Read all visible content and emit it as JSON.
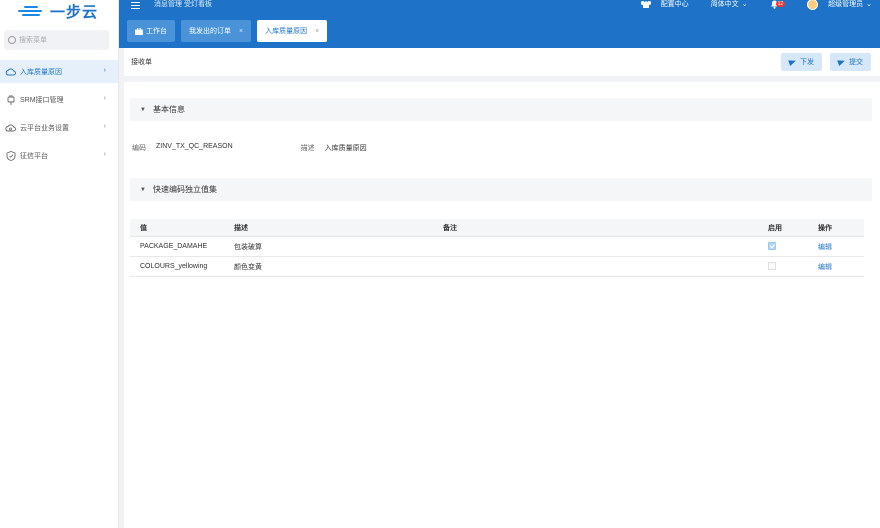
{
  "brand": {
    "logo_text": "一步云",
    "accent": "#1e73c8"
  },
  "sidebar": {
    "search_placeholder": "搜索菜单",
    "items": [
      {
        "label": "入库质量原因",
        "icon": "cloud-icon",
        "active": true
      },
      {
        "label": "SRM接口管理",
        "icon": "plug-icon",
        "active": false
      },
      {
        "label": "云平台业务设置",
        "icon": "cloud-settings-icon",
        "active": false
      },
      {
        "label": "征信平台",
        "icon": "shield-icon",
        "active": false
      }
    ]
  },
  "header": {
    "breadcrumb": "消息管理 受灯看板",
    "notify_center": "配置中心",
    "language": "简体中文",
    "notification_count": "12",
    "user": "超级管理员"
  },
  "tabs": [
    {
      "label": "工作台",
      "closable": false,
      "active": false
    },
    {
      "label": "我发出的订单",
      "closable": true,
      "active": false
    },
    {
      "label": "入库质量原因",
      "closable": true,
      "active": true
    }
  ],
  "toolbar": {
    "title": "接收单",
    "issue_label": "下发",
    "submit_label": "提交"
  },
  "basic_info": {
    "section_title": "基本信息",
    "code_label": "编码",
    "code_value": "ZINV_TX_QC_REASON",
    "desc_label": "描述",
    "desc_value": "入库质量原因"
  },
  "value_set": {
    "section_title": "快速编码独立值集",
    "columns": [
      "值",
      "描述",
      "备注",
      "启用",
      "操作"
    ],
    "rows": [
      {
        "value": "PACKAGE_DAMAHE",
        "desc": "包装破算",
        "remark": "",
        "enabled": true,
        "action": "编辑"
      },
      {
        "value": "COLOURS_yellowing",
        "desc": "颜色变黄",
        "remark": "",
        "enabled": false,
        "action": "编辑"
      }
    ]
  }
}
